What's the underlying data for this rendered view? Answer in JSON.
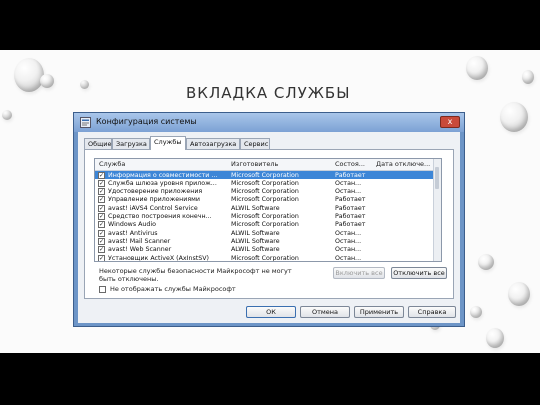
{
  "slide": {
    "heading": "ВКЛАДКА СЛУЖБЫ"
  },
  "window": {
    "title": "Конфигурация системы",
    "close_glyph": "x",
    "tabs": [
      {
        "label": "Общие",
        "active": false
      },
      {
        "label": "Загрузка",
        "active": false
      },
      {
        "label": "Службы",
        "active": true
      },
      {
        "label": "Автозагрузка",
        "active": false
      },
      {
        "label": "Сервис",
        "active": false
      }
    ],
    "columns": [
      "Служба",
      "Изготовитель",
      "Состоя...",
      "Дата отключе..."
    ],
    "rows": [
      {
        "name": "Информация о совместимости ...",
        "vendor": "Microsoft Corporation",
        "status": "Работает",
        "checked": true,
        "selected": true
      },
      {
        "name": "Служба шлюза уровня прилож...",
        "vendor": "Microsoft Corporation",
        "status": "Остан...",
        "checked": true,
        "selected": false
      },
      {
        "name": "Удостоверение приложения",
        "vendor": "Microsoft Corporation",
        "status": "Остан...",
        "checked": true,
        "selected": false
      },
      {
        "name": "Управление приложениями",
        "vendor": "Microsoft Corporation",
        "status": "Работает",
        "checked": true,
        "selected": false
      },
      {
        "name": "avast! iAVS4 Control Service",
        "vendor": "ALWIL Software",
        "status": "Работает",
        "checked": true,
        "selected": false
      },
      {
        "name": "Средство построения конечн...",
        "vendor": "Microsoft Corporation",
        "status": "Работает",
        "checked": true,
        "selected": false
      },
      {
        "name": "Windows Audio",
        "vendor": "Microsoft Corporation",
        "status": "Работает",
        "checked": true,
        "selected": false
      },
      {
        "name": "avast! Antivirus",
        "vendor": "ALWIL Software",
        "status": "Остан...",
        "checked": true,
        "selected": false
      },
      {
        "name": "avast! Mail Scanner",
        "vendor": "ALWIL Software",
        "status": "Остан...",
        "checked": true,
        "selected": false
      },
      {
        "name": "avast! Web Scanner",
        "vendor": "ALWIL Software",
        "status": "Остан...",
        "checked": true,
        "selected": false
      },
      {
        "name": "Установщик ActiveX (AxInstSV)",
        "vendor": "Microsoft Corporation",
        "status": "Остан...",
        "checked": true,
        "selected": false
      }
    ],
    "note": "Некоторые службы безопасности Майкрософт не могут быть отключены.",
    "enable_all": "Включить все",
    "disable_all": "Отключить все",
    "hide_ms_label": "Не отображать службы Майкрософт",
    "buttons": {
      "ok": "ОК",
      "cancel": "Отмена",
      "apply": "Применить",
      "help": "Справка"
    },
    "checkmark": "✓"
  }
}
